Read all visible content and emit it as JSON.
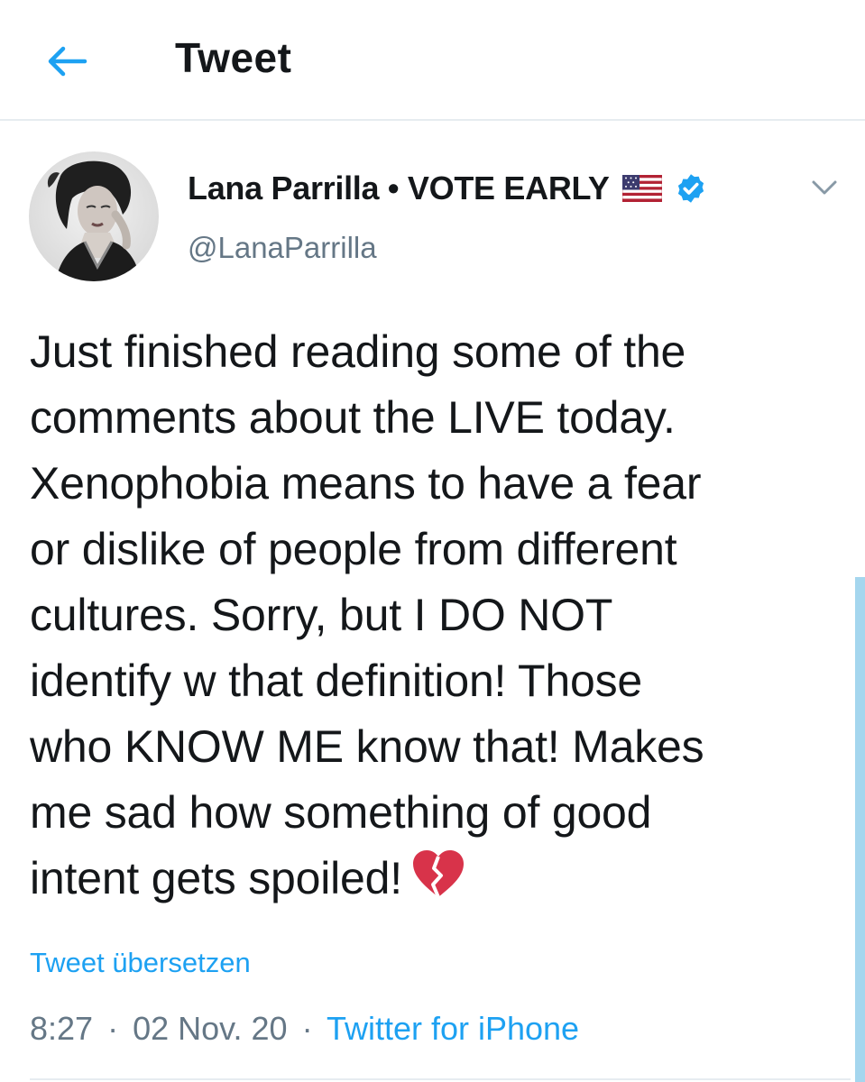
{
  "header": {
    "title": "Tweet",
    "back_icon": "arrow-left-icon"
  },
  "author": {
    "display_name": "Lana Parrilla • VOTE EARLY",
    "flag": "us-flag-icon",
    "verified": "verified-badge-icon",
    "handle": "@LanaParrilla"
  },
  "tweet": {
    "lines": [
      "Just finished reading some of the",
      "comments about the LIVE today.",
      "Xenophobia means to have a fear",
      "or dislike of people from different",
      "cultures. Sorry, but I DO NOT",
      "identify w that definition! Those",
      "who KNOW ME know that! Makes",
      "me sad how something of good",
      "intent gets spoiled!"
    ],
    "emoji": "broken-heart-icon",
    "translate_label": "Tweet übersetzen"
  },
  "meta": {
    "time": "8:27",
    "separator": "·",
    "date": "02 Nov. 20",
    "source": "Twitter for iPhone"
  },
  "colors": {
    "accent": "#1da1f2",
    "text": "#14171a",
    "secondary": "#657786",
    "divider": "#e6ecf0"
  }
}
